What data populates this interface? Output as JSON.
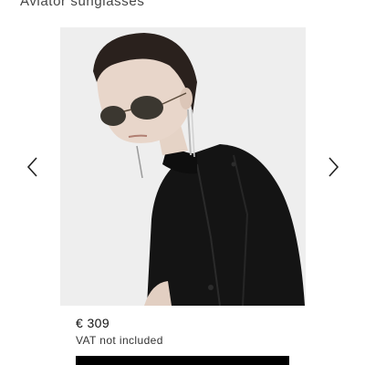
{
  "product": {
    "title": "Aviator sunglasses",
    "price": "€ 309",
    "vat_note": "VAT not included"
  },
  "gallery": {
    "prev_icon": "chevron-left-icon",
    "next_icon": "chevron-right-icon",
    "image_description_icon": "model-wearing-sunglasses-photo"
  },
  "colors": {
    "background": "#ffffff",
    "image_bg": "#eeeeee",
    "button": "#000000",
    "coat": "#141414"
  }
}
